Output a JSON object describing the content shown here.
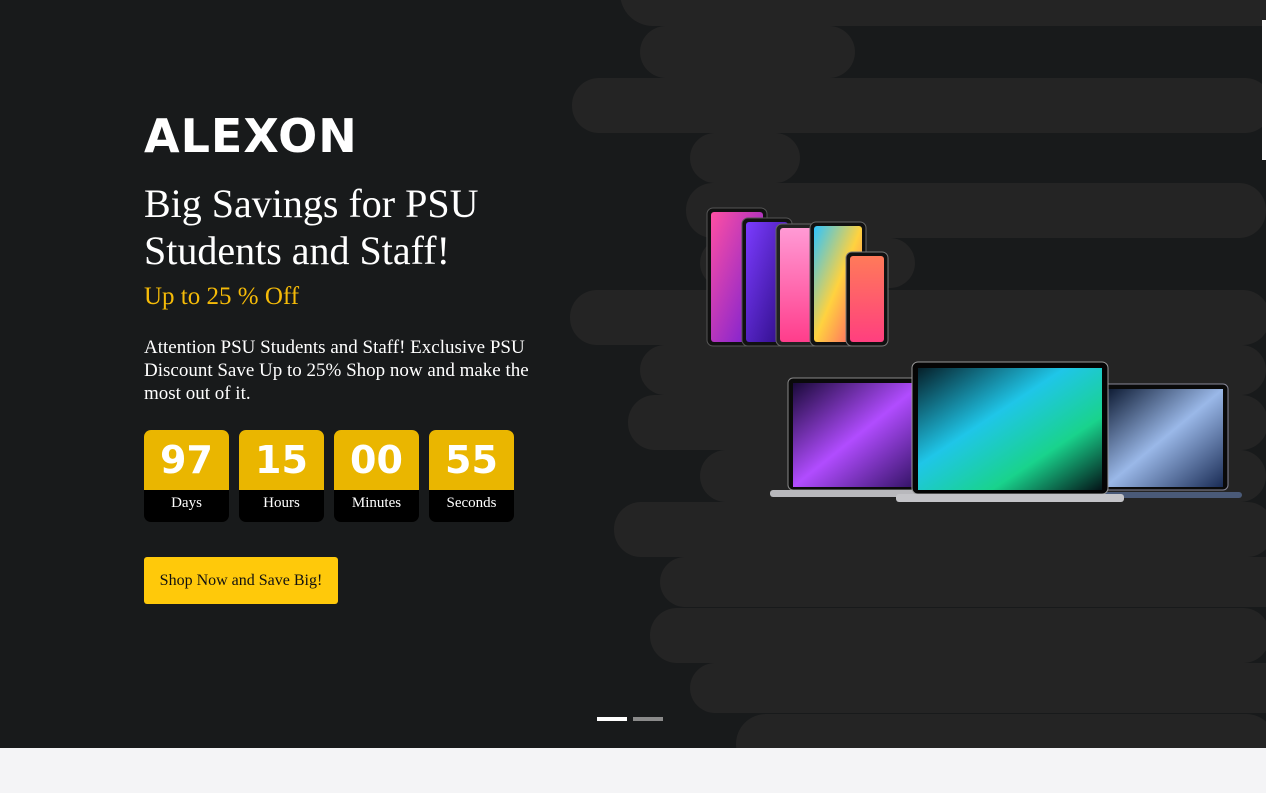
{
  "brand": {
    "logo_text": "ALEXON"
  },
  "hero": {
    "headline": "Big Savings for PSU Students and Staff!",
    "offer": "Up to 25 % Off",
    "description": "Attention PSU Students and Staff! Exclusive PSU Discount Save Up to 25% Shop now and make the most out of it.",
    "cta_label": "Shop Now and Save Big!"
  },
  "countdown": [
    {
      "value": "97",
      "label": "Days"
    },
    {
      "value": "15",
      "label": "Hours"
    },
    {
      "value": "00",
      "label": "Minutes"
    },
    {
      "value": "55",
      "label": "Seconds"
    }
  ],
  "carousel": {
    "slides": 2,
    "active": 1
  },
  "colors": {
    "background": "#181a1b",
    "accent": "#ffc90a",
    "countdown_number_bg": "#eab600",
    "offer_text": "#f5bb08"
  },
  "images": {
    "devices": "tablets-and-laptops-product-image"
  }
}
